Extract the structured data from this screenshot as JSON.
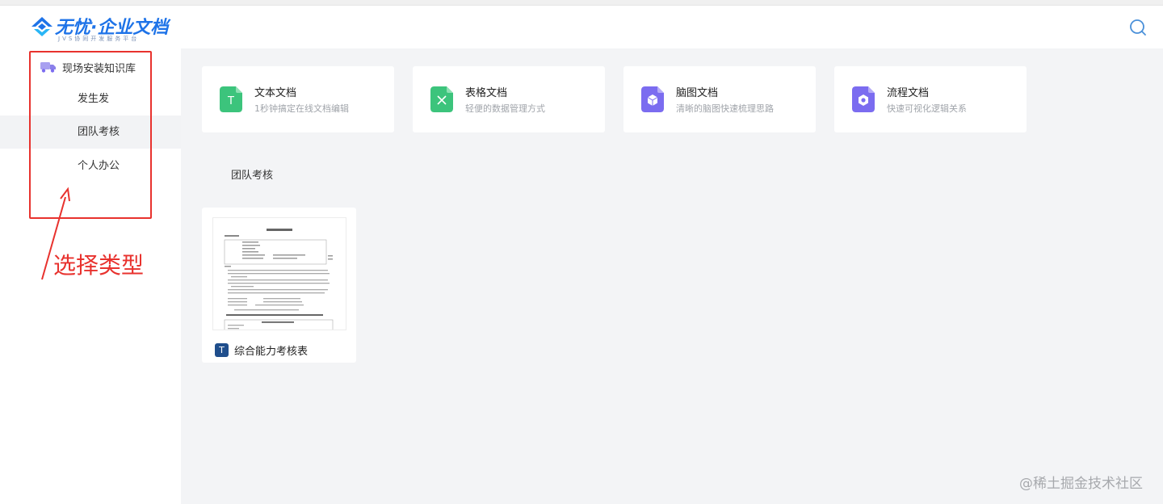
{
  "header": {
    "logo_title": "无忧·企业文档",
    "logo_subtitle": "JVS协同开发服务平台",
    "brand_color": "#1e73e8",
    "search_icon": "search-icon"
  },
  "sidebar": {
    "knowledge_base": "现场安装知识库",
    "items": [
      {
        "label": "发生发"
      },
      {
        "label": "团队考核"
      },
      {
        "label": "个人办公"
      }
    ],
    "active_index": 1
  },
  "annotation": {
    "text": "选择类型",
    "color": "#e8322e"
  },
  "doc_types": [
    {
      "title": "文本文档",
      "desc": "1秒钟搞定在线文档编辑",
      "icon": "text-doc-icon",
      "color": "#3cc47c",
      "glyph": "T"
    },
    {
      "title": "表格文档",
      "desc": "轻便的数据管理方式",
      "icon": "sheet-doc-icon",
      "color": "#3cc47c",
      "glyph": "×"
    },
    {
      "title": "脑图文档",
      "desc": "清晰的脑图快速梳理思路",
      "icon": "mindmap-doc-icon",
      "color": "#7b6cf0",
      "glyph": "⬢"
    },
    {
      "title": "流程文档",
      "desc": "快速可视化逻辑关系",
      "icon": "flow-doc-icon",
      "color": "#7b6cf0",
      "glyph": "●"
    }
  ],
  "section": {
    "title": "团队考核"
  },
  "documents": [
    {
      "name": "综合能力考核表",
      "type_glyph": "T",
      "badge_color": "#1f4e8c"
    }
  ],
  "watermark": "@稀土掘金技术社区"
}
